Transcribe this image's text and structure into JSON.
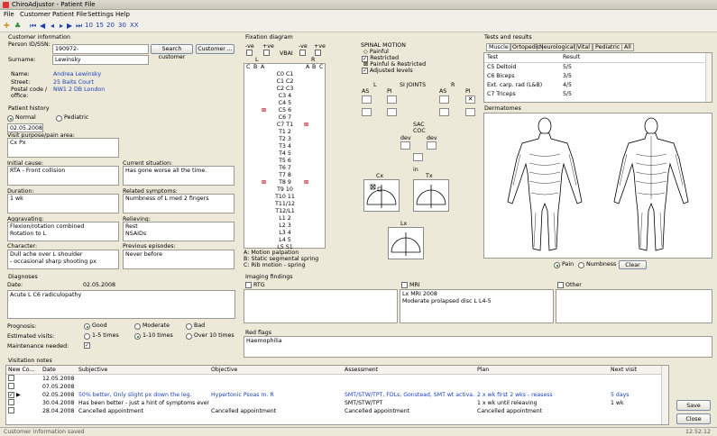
{
  "app": {
    "title": "ChiroAdjustor - Patient File"
  },
  "menu": [
    "File",
    "Customer",
    "Patient File",
    "Settings",
    "Help"
  ],
  "toolbar": {
    "nums": [
      "10",
      "15",
      "20",
      "30",
      "XX"
    ]
  },
  "customer": {
    "section": "Customer information",
    "person_id_label": "Person ID/SSN:",
    "person_id": "190972-",
    "search_btn": "Search customer",
    "customer_btn": "Customer ...",
    "surname_label": "Surname:",
    "surname": "Lewinsky",
    "name_label": "Name:",
    "name": "Andrea Lewinsky",
    "street_label": "Street:",
    "street": "25 Baits Court",
    "postal_label": "Postal code / office:",
    "postal": "NW1 2 DB London"
  },
  "history": {
    "section": "Patient history",
    "normal": "Normal",
    "pediatric": "Pediatric",
    "date": "02.05.2008",
    "visit_label": "Visit purpose/pain area:",
    "visit": "Cx Px",
    "initial_label": "Initial cause:",
    "initial": "RTA - Front collision",
    "current_label": "Current situation:",
    "current": "Has gone worse all the time.",
    "duration_label": "Duration:",
    "duration": "1 wk",
    "related_label": "Related symptoms:",
    "related": "Numbness of L med 2 fingers",
    "aggr_label": "Aggravating:",
    "aggr": "Flexion/rotation combined\nRotation to L",
    "reliev_label": "Relieving:",
    "reliev": "Rest\nNSAIDs",
    "char_label": "Character:",
    "char": "Dull ache over L shoulder\n- occasional sharp shooting px",
    "prev_label": "Previous episodes:",
    "prev": "Never before"
  },
  "diagnosis": {
    "section": "Diagnoses",
    "date_label": "Date:",
    "date": "02.05.2008",
    "text": "Acute L C6 radiculopathy"
  },
  "prognosis": {
    "label": "Prognosis:",
    "opts": [
      "Good",
      "Moderate",
      "Bad"
    ],
    "est_label": "Estimated visits:",
    "est_opts": [
      "1-5 times",
      "1-10 times",
      "Over 10 times"
    ],
    "maint_label": "Maintenance needed:"
  },
  "fixation": {
    "section": "Fixation diagram",
    "ve_left": "-ve",
    "ve_right": "+ve",
    "vbai": "VBAI",
    "ve_left2": "-ve",
    "ve_right2": "+ve",
    "col_L": "L",
    "col_R": "R",
    "cols_left": [
      "C",
      "B",
      "A"
    ],
    "cols_right": [
      "A",
      "B",
      "C"
    ],
    "segments": [
      "C0 C1",
      "C1 C2",
      "C2 C3",
      "C3 4",
      "C4 5",
      "C5 6",
      "C6 7",
      "C7 T1",
      "T1 2",
      "T2 3",
      "T3 4",
      "T4 5",
      "T5 6",
      "T6 7",
      "T7 8",
      "T8 9",
      "T9 10",
      "T10 11",
      "T11/12",
      "T12/L1",
      "L1 2",
      "L2 3",
      "L3 4",
      "L4 5",
      "L5 S1"
    ],
    "legend": [
      "A: Motion palpation",
      "B: Static segmental spring",
      "C: Rib motion - spring"
    ]
  },
  "spinal": {
    "title": "SPINAL MOTION",
    "legend": [
      "Painful",
      "Restricted",
      "Painful & Restricted",
      "Adjusted levels"
    ],
    "si": "SI JOINTS",
    "L": "L",
    "R": "R",
    "as1": "AS",
    "pi1": "PI",
    "as2": "AS",
    "pi2": "PI",
    "sac": "SAC",
    "coc": "COC",
    "dev1": "dev",
    "dev2": "dev",
    "in": "in",
    "cx": "Cx",
    "tx": "Tx",
    "lx": "Lx"
  },
  "tests": {
    "section": "Tests and results",
    "tabs": [
      "Muscle",
      "Ortopedic",
      "Neurological",
      "Vital",
      "Pediatric",
      "All"
    ],
    "head": [
      "Test",
      "Result"
    ],
    "rows": [
      [
        "C5 Deltoid",
        "5/5"
      ],
      [
        "C6 Biceps",
        "3/5"
      ],
      [
        "Ext. carp. rad (L&B)",
        "4/5"
      ],
      [
        "C7 Triceps",
        "5/5"
      ]
    ]
  },
  "derm": {
    "section": "Dermatomes",
    "pain": "Pain",
    "numb": "Numbness",
    "clear": "Clear"
  },
  "imaging": {
    "section": "Imaging findings",
    "rtg": "RTG",
    "mri": "MRI",
    "other": "Other",
    "mri_text": "Lx MRI 2008\nModerate prolapsed disc L L4-5"
  },
  "flags": {
    "section": "Red flags",
    "text": "Haemophilia"
  },
  "visits": {
    "section": "Visitation notes",
    "head": [
      "New Co...",
      "Date",
      "Subjective",
      "Objective",
      "Assessment",
      "Plan",
      "Next visit"
    ],
    "rows": [
      [
        "",
        "12.05.2008",
        "",
        "",
        "",
        "",
        ""
      ],
      [
        "",
        "07.05.2008",
        "",
        "",
        "",
        "",
        ""
      ],
      [
        "",
        "02.05.2008",
        "50% better, Only slight px down the leg.",
        "Hypertonic Psoas m. R",
        "SMT/STW/TPT, FDLs, Gonstead, SMT wt activa...",
        "2 x wk first 2 wks - reasess",
        "5 days"
      ],
      [
        "",
        "30.04.2008",
        "Has been better - just a hint of symptoms ever...",
        "",
        "SMT/STW/TPT",
        "1 x wk until releaving",
        "1 wk"
      ],
      [
        "",
        "28.04.2008",
        "Cancelled appointment",
        "Cancelled appointment",
        "Cancelled appointment",
        "Cancelled appointment",
        ""
      ]
    ]
  },
  "buttons": {
    "save": "Save",
    "close": "Close"
  },
  "status": {
    "left": "Customer information saved",
    "right": "12.52.12"
  }
}
